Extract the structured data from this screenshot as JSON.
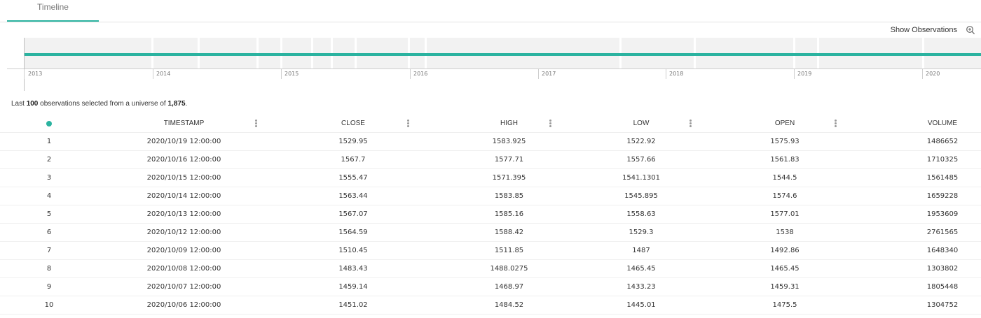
{
  "tabs": [
    {
      "label": "Timeline"
    }
  ],
  "toolbar": {
    "show_observations_label": "Show Observations"
  },
  "timeline": {
    "years": [
      "2013",
      "2014",
      "2015",
      "2016",
      "2017",
      "2018",
      "2019",
      "2020"
    ]
  },
  "summary": {
    "prefix": "Last",
    "count": "100",
    "middle": "observations selected from a universe of",
    "universe": "1,875"
  },
  "table": {
    "columns": [
      "TIMESTAMP",
      "CLOSE",
      "HIGH",
      "LOW",
      "OPEN",
      "VOLUME"
    ],
    "rows": [
      {
        "idx": "1",
        "timestamp": "2020/10/19 12:00:00",
        "close": "1529.95",
        "high": "1583.925",
        "low": "1522.92",
        "open": "1575.93",
        "volume": "1486652"
      },
      {
        "idx": "2",
        "timestamp": "2020/10/16 12:00:00",
        "close": "1567.7",
        "high": "1577.71",
        "low": "1557.66",
        "open": "1561.83",
        "volume": "1710325"
      },
      {
        "idx": "3",
        "timestamp": "2020/10/15 12:00:00",
        "close": "1555.47",
        "high": "1571.395",
        "low": "1541.1301",
        "open": "1544.5",
        "volume": "1561485"
      },
      {
        "idx": "4",
        "timestamp": "2020/10/14 12:00:00",
        "close": "1563.44",
        "high": "1583.85",
        "low": "1545.895",
        "open": "1574.6",
        "volume": "1659228"
      },
      {
        "idx": "5",
        "timestamp": "2020/10/13 12:00:00",
        "close": "1567.07",
        "high": "1585.16",
        "low": "1558.63",
        "open": "1577.01",
        "volume": "1953609"
      },
      {
        "idx": "6",
        "timestamp": "2020/10/12 12:00:00",
        "close": "1564.59",
        "high": "1588.42",
        "low": "1529.3",
        "open": "1538",
        "volume": "2761565"
      },
      {
        "idx": "7",
        "timestamp": "2020/10/09 12:00:00",
        "close": "1510.45",
        "high": "1511.85",
        "low": "1487",
        "open": "1492.86",
        "volume": "1648340"
      },
      {
        "idx": "8",
        "timestamp": "2020/10/08 12:00:00",
        "close": "1483.43",
        "high": "1488.0275",
        "low": "1465.45",
        "open": "1465.45",
        "volume": "1303802"
      },
      {
        "idx": "9",
        "timestamp": "2020/10/07 12:00:00",
        "close": "1459.14",
        "high": "1468.97",
        "low": "1433.23",
        "open": "1459.31",
        "volume": "1805448"
      },
      {
        "idx": "10",
        "timestamp": "2020/10/06 12:00:00",
        "close": "1451.02",
        "high": "1484.52",
        "low": "1445.01",
        "open": "1475.5",
        "volume": "1304752"
      }
    ]
  },
  "colors": {
    "accent": "#2bb3a0"
  }
}
